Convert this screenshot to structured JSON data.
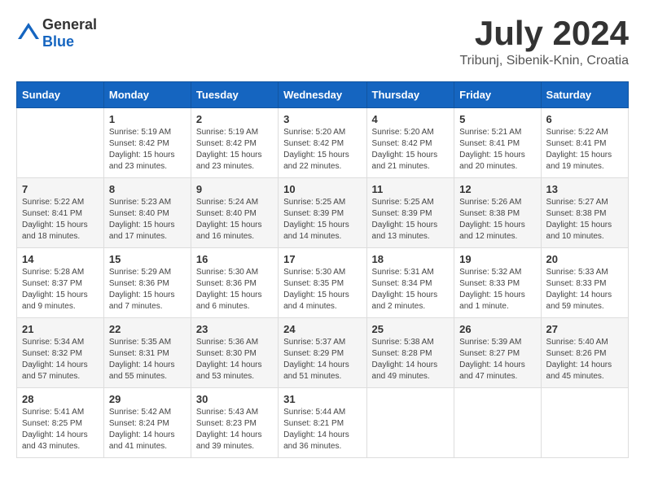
{
  "header": {
    "logo_general": "General",
    "logo_blue": "Blue",
    "month_title": "July 2024",
    "subtitle": "Tribunj, Sibenik-Knin, Croatia"
  },
  "weekdays": [
    "Sunday",
    "Monday",
    "Tuesday",
    "Wednesday",
    "Thursday",
    "Friday",
    "Saturday"
  ],
  "weeks": [
    [
      {
        "day": "",
        "info": ""
      },
      {
        "day": "1",
        "info": "Sunrise: 5:19 AM\nSunset: 8:42 PM\nDaylight: 15 hours\nand 23 minutes."
      },
      {
        "day": "2",
        "info": "Sunrise: 5:19 AM\nSunset: 8:42 PM\nDaylight: 15 hours\nand 23 minutes."
      },
      {
        "day": "3",
        "info": "Sunrise: 5:20 AM\nSunset: 8:42 PM\nDaylight: 15 hours\nand 22 minutes."
      },
      {
        "day": "4",
        "info": "Sunrise: 5:20 AM\nSunset: 8:42 PM\nDaylight: 15 hours\nand 21 minutes."
      },
      {
        "day": "5",
        "info": "Sunrise: 5:21 AM\nSunset: 8:41 PM\nDaylight: 15 hours\nand 20 minutes."
      },
      {
        "day": "6",
        "info": "Sunrise: 5:22 AM\nSunset: 8:41 PM\nDaylight: 15 hours\nand 19 minutes."
      }
    ],
    [
      {
        "day": "7",
        "info": "Sunrise: 5:22 AM\nSunset: 8:41 PM\nDaylight: 15 hours\nand 18 minutes."
      },
      {
        "day": "8",
        "info": "Sunrise: 5:23 AM\nSunset: 8:40 PM\nDaylight: 15 hours\nand 17 minutes."
      },
      {
        "day": "9",
        "info": "Sunrise: 5:24 AM\nSunset: 8:40 PM\nDaylight: 15 hours\nand 16 minutes."
      },
      {
        "day": "10",
        "info": "Sunrise: 5:25 AM\nSunset: 8:39 PM\nDaylight: 15 hours\nand 14 minutes."
      },
      {
        "day": "11",
        "info": "Sunrise: 5:25 AM\nSunset: 8:39 PM\nDaylight: 15 hours\nand 13 minutes."
      },
      {
        "day": "12",
        "info": "Sunrise: 5:26 AM\nSunset: 8:38 PM\nDaylight: 15 hours\nand 12 minutes."
      },
      {
        "day": "13",
        "info": "Sunrise: 5:27 AM\nSunset: 8:38 PM\nDaylight: 15 hours\nand 10 minutes."
      }
    ],
    [
      {
        "day": "14",
        "info": "Sunrise: 5:28 AM\nSunset: 8:37 PM\nDaylight: 15 hours\nand 9 minutes."
      },
      {
        "day": "15",
        "info": "Sunrise: 5:29 AM\nSunset: 8:36 PM\nDaylight: 15 hours\nand 7 minutes."
      },
      {
        "day": "16",
        "info": "Sunrise: 5:30 AM\nSunset: 8:36 PM\nDaylight: 15 hours\nand 6 minutes."
      },
      {
        "day": "17",
        "info": "Sunrise: 5:30 AM\nSunset: 8:35 PM\nDaylight: 15 hours\nand 4 minutes."
      },
      {
        "day": "18",
        "info": "Sunrise: 5:31 AM\nSunset: 8:34 PM\nDaylight: 15 hours\nand 2 minutes."
      },
      {
        "day": "19",
        "info": "Sunrise: 5:32 AM\nSunset: 8:33 PM\nDaylight: 15 hours\nand 1 minute."
      },
      {
        "day": "20",
        "info": "Sunrise: 5:33 AM\nSunset: 8:33 PM\nDaylight: 14 hours\nand 59 minutes."
      }
    ],
    [
      {
        "day": "21",
        "info": "Sunrise: 5:34 AM\nSunset: 8:32 PM\nDaylight: 14 hours\nand 57 minutes."
      },
      {
        "day": "22",
        "info": "Sunrise: 5:35 AM\nSunset: 8:31 PM\nDaylight: 14 hours\nand 55 minutes."
      },
      {
        "day": "23",
        "info": "Sunrise: 5:36 AM\nSunset: 8:30 PM\nDaylight: 14 hours\nand 53 minutes."
      },
      {
        "day": "24",
        "info": "Sunrise: 5:37 AM\nSunset: 8:29 PM\nDaylight: 14 hours\nand 51 minutes."
      },
      {
        "day": "25",
        "info": "Sunrise: 5:38 AM\nSunset: 8:28 PM\nDaylight: 14 hours\nand 49 minutes."
      },
      {
        "day": "26",
        "info": "Sunrise: 5:39 AM\nSunset: 8:27 PM\nDaylight: 14 hours\nand 47 minutes."
      },
      {
        "day": "27",
        "info": "Sunrise: 5:40 AM\nSunset: 8:26 PM\nDaylight: 14 hours\nand 45 minutes."
      }
    ],
    [
      {
        "day": "28",
        "info": "Sunrise: 5:41 AM\nSunset: 8:25 PM\nDaylight: 14 hours\nand 43 minutes."
      },
      {
        "day": "29",
        "info": "Sunrise: 5:42 AM\nSunset: 8:24 PM\nDaylight: 14 hours\nand 41 minutes."
      },
      {
        "day": "30",
        "info": "Sunrise: 5:43 AM\nSunset: 8:23 PM\nDaylight: 14 hours\nand 39 minutes."
      },
      {
        "day": "31",
        "info": "Sunrise: 5:44 AM\nSunset: 8:21 PM\nDaylight: 14 hours\nand 36 minutes."
      },
      {
        "day": "",
        "info": ""
      },
      {
        "day": "",
        "info": ""
      },
      {
        "day": "",
        "info": ""
      }
    ]
  ]
}
